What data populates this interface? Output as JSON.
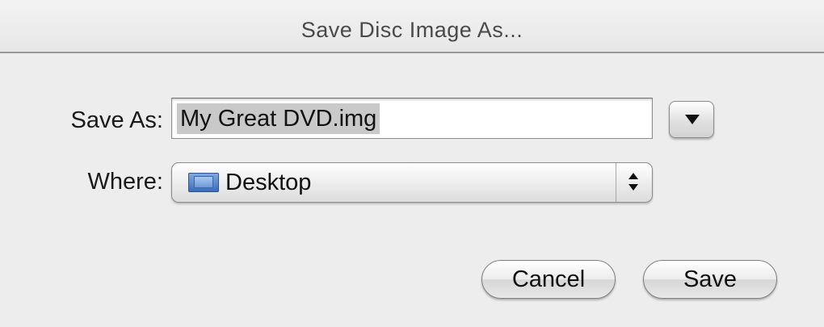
{
  "window": {
    "title": "Save Disc Image As..."
  },
  "form": {
    "save_as_label": "Save As:",
    "save_as_value": "My Great DVD.img",
    "where_label": "Where:",
    "where_value": "Desktop",
    "where_icon": "folder-icon",
    "expand_icon": "disclosure-triangle-icon"
  },
  "buttons": {
    "cancel_label": "Cancel",
    "save_label": "Save"
  },
  "colors": {
    "window_background": "#ededed",
    "selection_highlight": "#c9c9c9",
    "folder_blue": "#3c6db8"
  }
}
